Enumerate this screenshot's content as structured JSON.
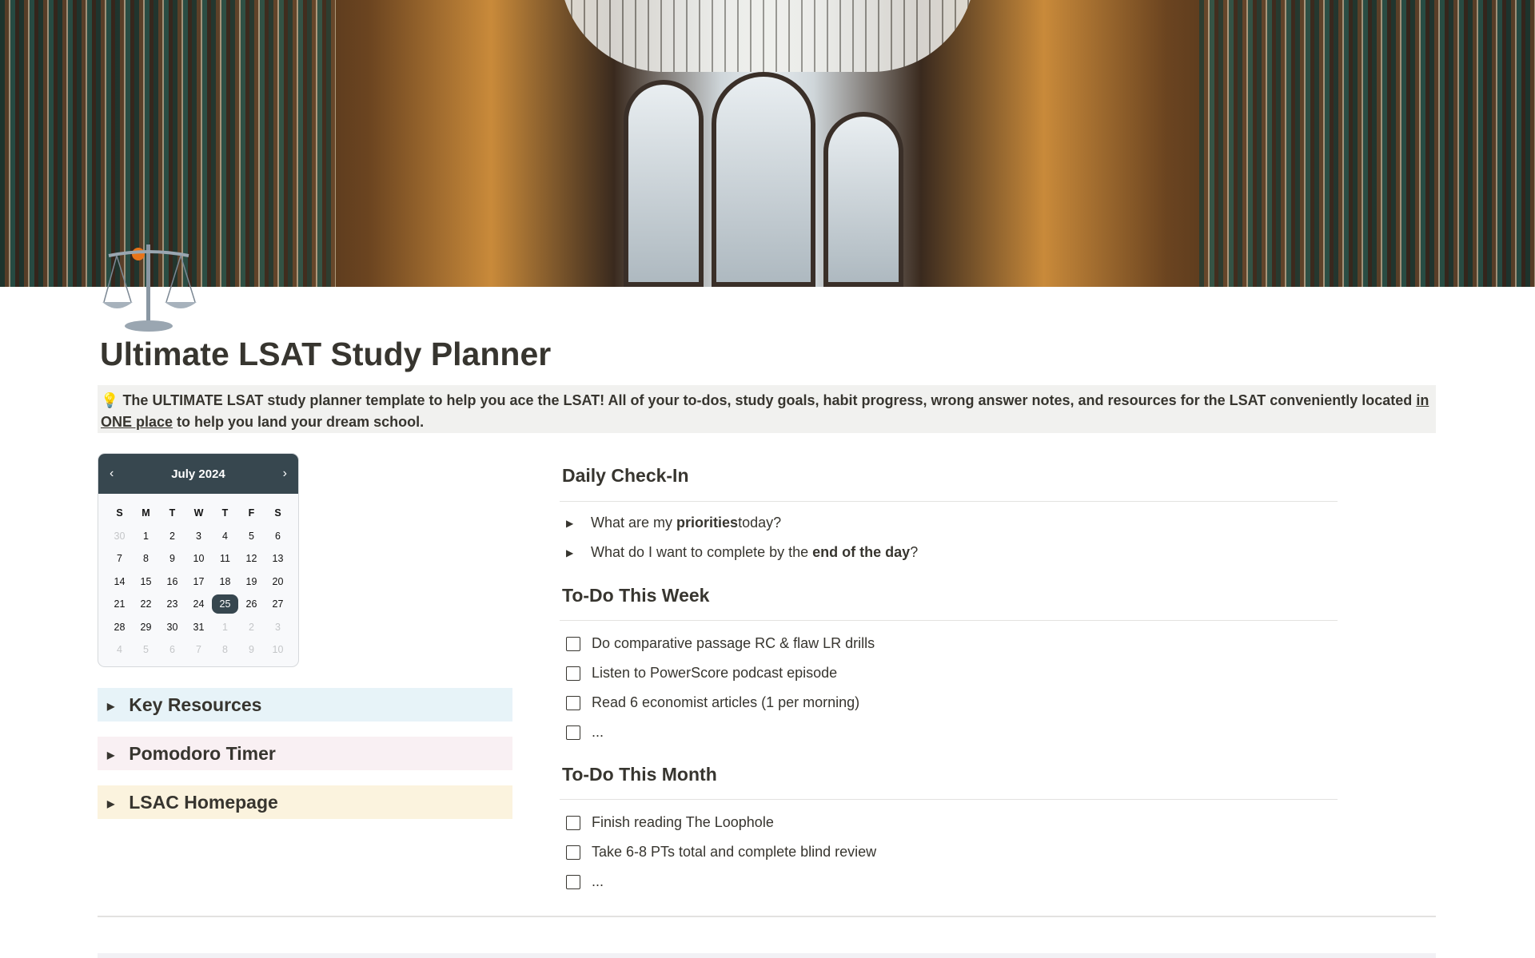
{
  "page": {
    "title": "Ultimate LSAT Study Planner",
    "icon": "balance-scale-icon",
    "callout": {
      "icon": "lightbulb-icon",
      "text_before": "The ULTIMATE LSAT study planner template to help you ace the LSAT! All of your to-dos, study goals, habit progress, wrong answer notes, and resources for the LSAT conveniently located ",
      "link": "in ONE place",
      "text_after": " to help you land your dream school."
    }
  },
  "calendar": {
    "month_label": "July 2024",
    "prev": "‹",
    "next": "›",
    "weekdays": [
      "S",
      "M",
      "T",
      "W",
      "T",
      "F",
      "S"
    ],
    "days": [
      "30",
      "1",
      "2",
      "3",
      "4",
      "5",
      "6",
      "7",
      "8",
      "9",
      "10",
      "11",
      "12",
      "13",
      "14",
      "15",
      "16",
      "17",
      "18",
      "19",
      "20",
      "21",
      "22",
      "23",
      "24",
      "25",
      "26",
      "27",
      "28",
      "29",
      "30",
      "31",
      "1",
      "2",
      "3",
      "4",
      "5",
      "6",
      "7",
      "8",
      "9",
      "10"
    ],
    "selected_day": "25"
  },
  "toggles": [
    {
      "label": "Key Resources",
      "color": "#e7f3f8"
    },
    {
      "label": "Pomodoro Timer",
      "color": "#f9f0f3"
    },
    {
      "label": "LSAC Homepage",
      "color": "#fbf3de"
    }
  ],
  "daily_checkin": {
    "heading": "Daily Check-In",
    "items": [
      {
        "pre": "What are my ",
        "bold": "priorities",
        "post": " today?"
      },
      {
        "pre": "What do I want to complete by the ",
        "bold": "end of the day",
        "post": "?"
      }
    ]
  },
  "todo_week": {
    "heading": "To-Do This Week",
    "items": [
      "Do comparative passage RC & flaw LR drills",
      "Listen to PowerScore podcast episode",
      "Read 6 economist articles (1 per morning)",
      "..."
    ]
  },
  "todo_month": {
    "heading": "To-Do This Month",
    "items": [
      "Finish reading The Loophole",
      "Take 6-8 PTs total and complete blind review",
      "..."
    ]
  }
}
